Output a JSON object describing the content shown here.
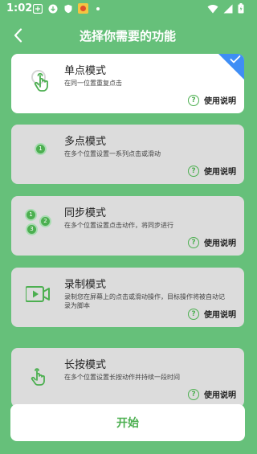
{
  "status_bar": {
    "time": "1:02"
  },
  "header": {
    "title": "选择你需要的功能"
  },
  "cards": [
    {
      "title": "单点模式",
      "desc": "在同一位置重复点击",
      "help": "使用说明",
      "selected": true
    },
    {
      "title": "多点模式",
      "desc": "在多个位置设置一系列点击或滑动",
      "help": "使用说明",
      "selected": false
    },
    {
      "title": "同步模式",
      "desc": "在多个位置设置点击动作，将同步进行",
      "help": "使用说明",
      "selected": false
    },
    {
      "title": "录制模式",
      "desc": "录制您在屏幕上的点击或滑动操作，目标操作将被自动记录为脚本",
      "help": "使用说明",
      "selected": false
    },
    {
      "title": "长按模式",
      "desc": "在多个位置设置长按动作并持续一段时间",
      "help": "使用说明",
      "selected": false
    }
  ],
  "icon_labels": {
    "multi": "1",
    "sync": [
      "1",
      "2",
      "3"
    ]
  },
  "start_button": {
    "label": "开始"
  },
  "colors": {
    "background": "#66c07a",
    "accent": "#4caf50",
    "selected_badge": "#3f8ef5"
  }
}
